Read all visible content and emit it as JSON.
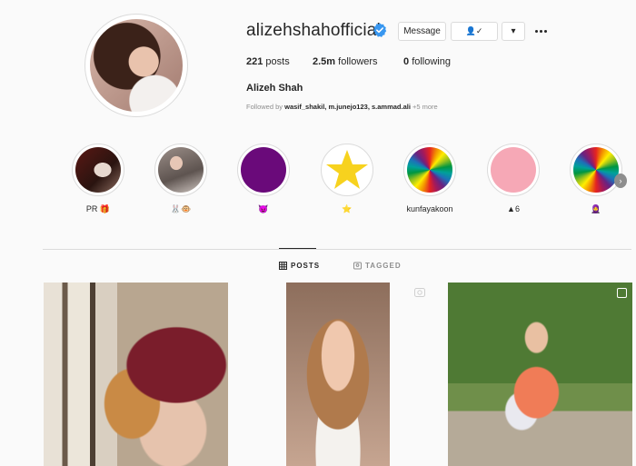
{
  "profile": {
    "username": "alizehshahofficial",
    "full_name": "Alizeh Shah",
    "message_label": "Message",
    "follow_icon_label": "👤✓",
    "dropdown_label": "▾",
    "stats": {
      "posts_count": "221",
      "posts_label": "posts",
      "followers_count": "2.5m",
      "followers_label": "followers",
      "following_count": "0",
      "following_label": "following"
    },
    "followed_by_prefix": "Followed by ",
    "followed_by_users": "wasif_shakil, m.junejo123, s.ammad.ali",
    "followed_by_more": " +5 more"
  },
  "highlights": [
    {
      "label": "PR 🎁",
      "cover": "photo-dark"
    },
    {
      "label": "🐰🐵",
      "cover": "photo-grey"
    },
    {
      "label": "😈",
      "cover": "purple"
    },
    {
      "label": "⭐",
      "cover": "star"
    },
    {
      "label": "kunfayakoon",
      "cover": "rainbow"
    },
    {
      "label": "▲6",
      "cover": "pink"
    },
    {
      "label": "🧕",
      "cover": "rainbow"
    }
  ],
  "tabs": {
    "posts_label": "POSTS",
    "tagged_label": "TAGGED"
  },
  "colors": {
    "verified": "#3897f0",
    "purple": "#6a0a7a",
    "pink": "#f6a8b6",
    "star": "#f7d21e"
  }
}
